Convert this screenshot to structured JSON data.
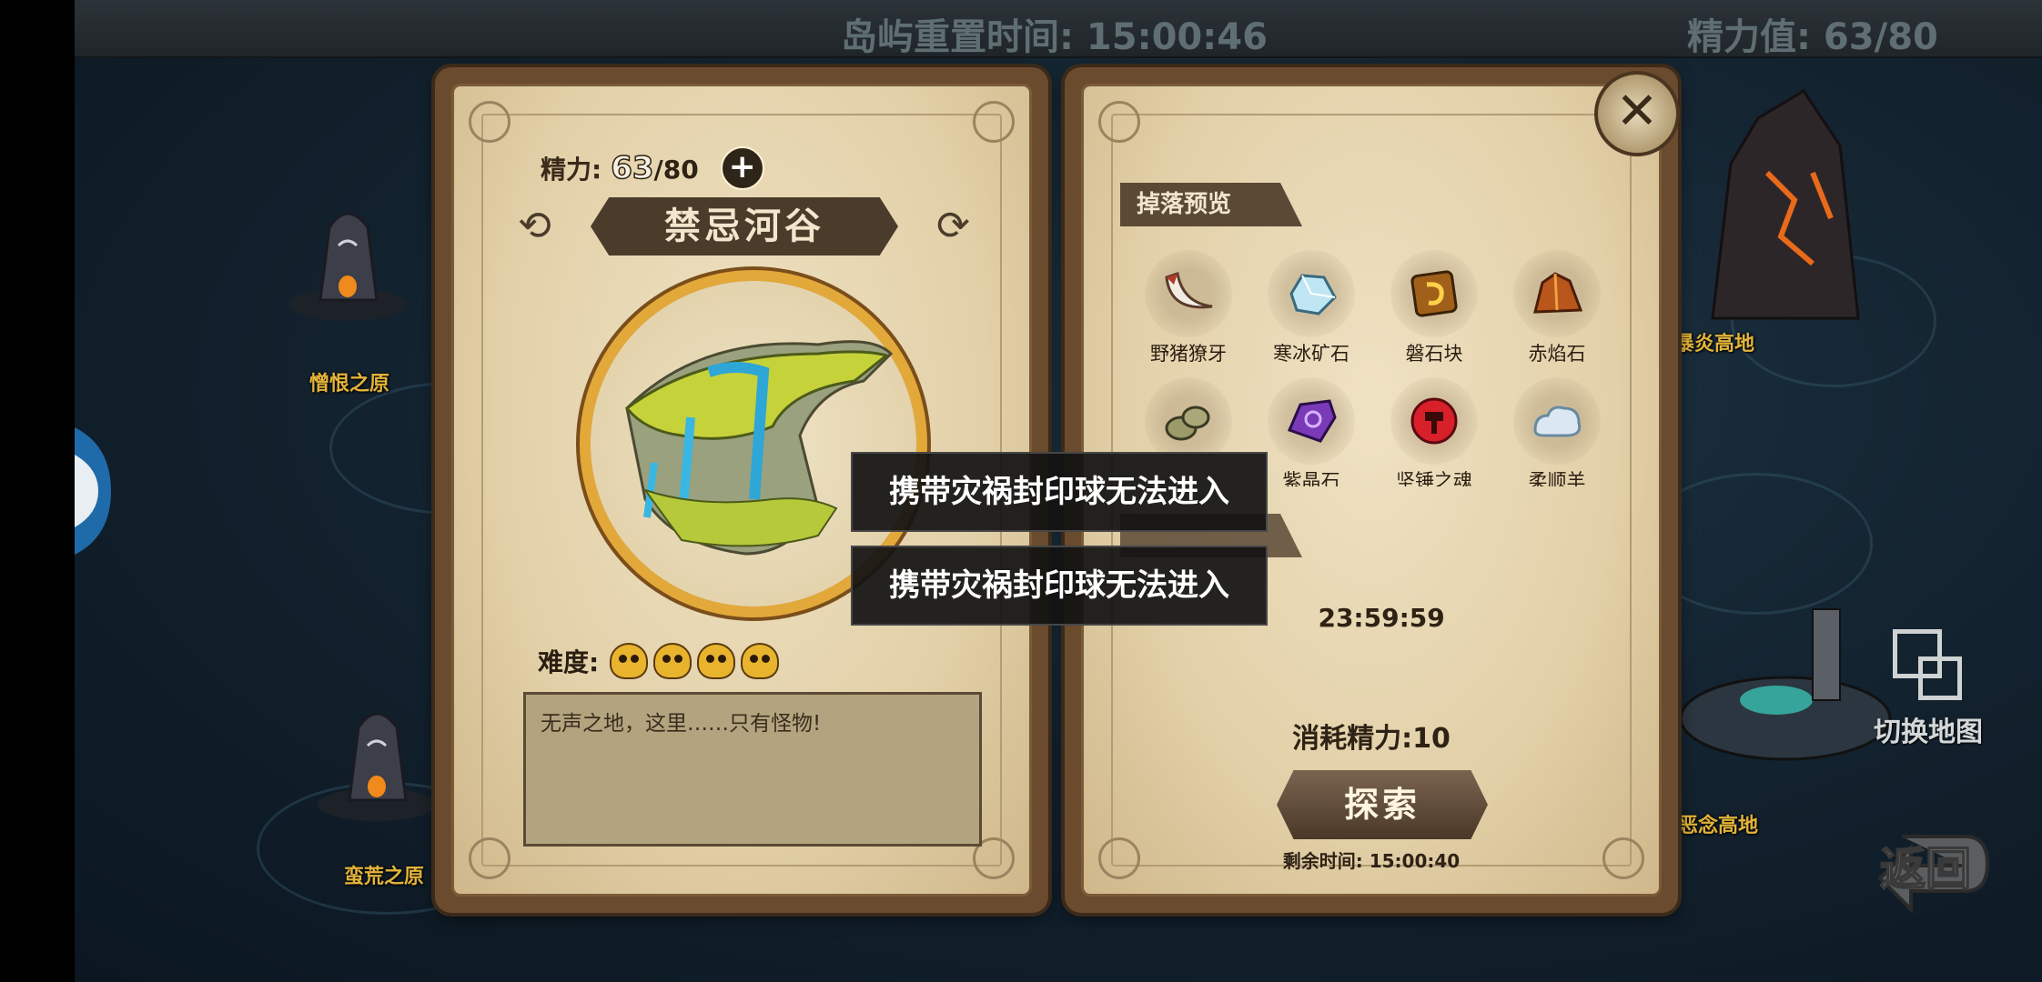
{
  "topbar": {
    "reset_time": "岛屿重置时间: 15:00:46",
    "stamina": "精力值: 63/80"
  },
  "map": {
    "labels": [
      "憎恨之原",
      "蛮荒之原",
      "暴炎高地",
      "恶念高地"
    ]
  },
  "left_panel": {
    "stamina_label": "精力:",
    "stamina_current": "63",
    "stamina_max": "/80",
    "add_icon": "plus-icon",
    "title": "禁忌河谷",
    "difficulty_label": "难度:",
    "difficulty_level": 4,
    "difficulty_icon": "skull-icon",
    "description": "无声之地，这里……只有怪物!"
  },
  "right_panel": {
    "drop_tab": "掉落预览",
    "drops": [
      {
        "name": "野猪獠牙",
        "icon": "tusk-icon"
      },
      {
        "name": "寒冰矿石",
        "icon": "ice-ore-icon"
      },
      {
        "name": "磐石块",
        "icon": "rock-block-icon"
      },
      {
        "name": "赤焰石",
        "icon": "flame-stone-icon"
      },
      {
        "name": "",
        "icon": "stones-icon"
      },
      {
        "name": "紫晶石",
        "icon": "amethyst-icon"
      },
      {
        "name": "坚锤之魂",
        "icon": "hammer-soul-icon"
      },
      {
        "name": "柔顺羊",
        "icon": "wool-icon"
      }
    ],
    "open_time_end": "23:59:59",
    "cost": "消耗精力:10",
    "explore_button": "探索",
    "remaining_time": "剩余时间: 15:00:40",
    "close_icon": "close-icon"
  },
  "toasts": [
    "携带灾祸封印球无法进入",
    "携带灾祸封印球无法进入"
  ],
  "side": {
    "switch_map_label": "切换地图",
    "back_label": "返回"
  }
}
